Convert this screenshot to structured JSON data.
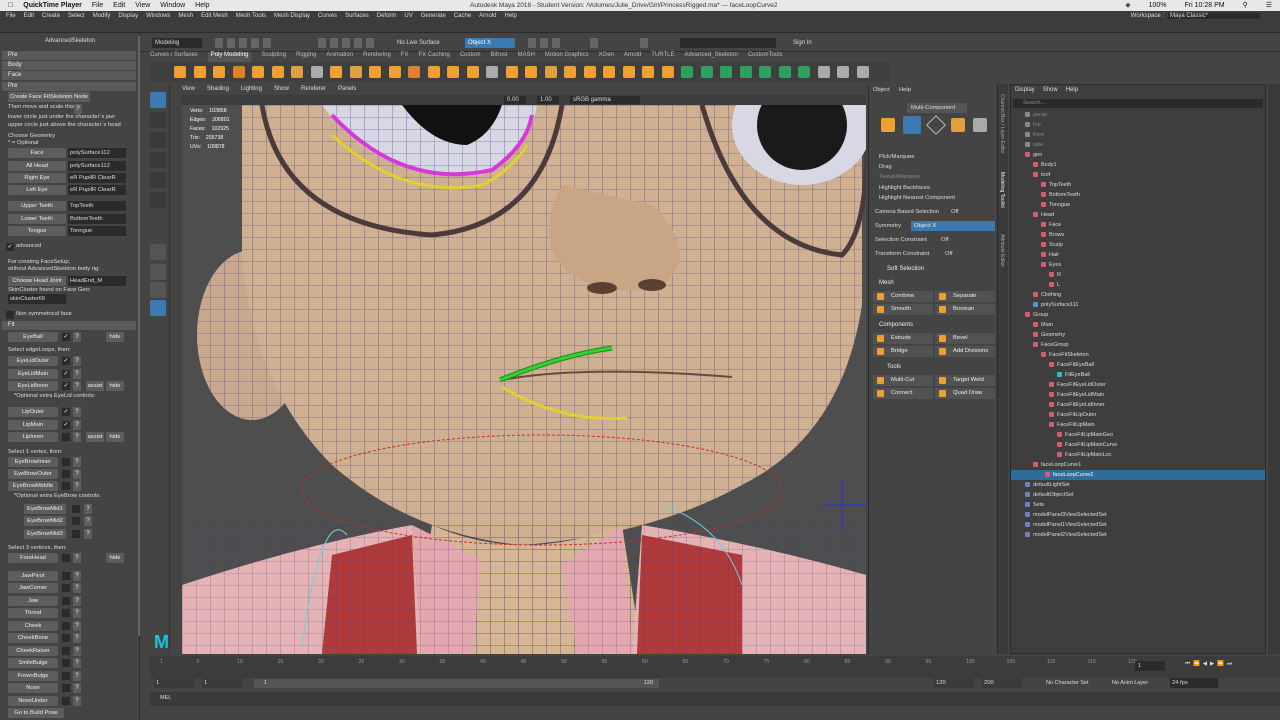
{
  "mac": {
    "app": "QuickTime Player",
    "menus": [
      "File",
      "Edit",
      "View",
      "Window",
      "Help"
    ],
    "window_title": "Autodesk Maya 2018 - Student Version: /Volumes/Julie_Drive/Girl/PrincessRigged.ma* --- faceLoopCurve2",
    "battery": "100%",
    "clock": "Fri 10:28 PM"
  },
  "maya_menu": {
    "items": [
      "File",
      "Edit",
      "Create",
      "Select",
      "Modify",
      "Display",
      "Windows",
      "Mesh",
      "Edit Mesh",
      "Mesh Tools",
      "Mesh Display",
      "Curves",
      "Surfaces",
      "Deform",
      "UV",
      "Generate",
      "Cache",
      "Arnold",
      "Help"
    ],
    "workspace_label": "Workspace :",
    "workspace_value": "Maya Classic*"
  },
  "statusline": {
    "mode": "Modeling",
    "live_surface": "No Live Surface",
    "symmetry": "Object X",
    "sign_in": "Sign In"
  },
  "shelf_tabs": [
    "Curves / Surfaces",
    "Poly Modeling",
    "Sculpting",
    "Rigging",
    "Animation",
    "Rendering",
    "FX",
    "FX Caching",
    "Custom",
    "Bifrost",
    "MASH",
    "Motion Graphics",
    "XGen",
    "Arnold",
    "TURTLE",
    "Advanced_Skeleton",
    "CustomTools"
  ],
  "left_panel": {
    "title": "AdvancedSkeleton",
    "sections": {
      "pre": "Pre",
      "body": "Body",
      "face": "Face",
      "pre2": "Pre",
      "fit": "Fit"
    },
    "create_btn": "Create Face FitSkeleton Node",
    "hint1": "Then move and scale this",
    "hint2": "lower circle just under the character`s jaw",
    "hint3": "upper circle just above the character`s head",
    "choose_geo": "Choose Geometry",
    "optional": "* = Optional",
    "geo_rows": [
      {
        "label": "Face",
        "value": "polySurface112"
      },
      {
        "label": "All Head",
        "value": "polySurface112"
      },
      {
        "label": "Right Eye",
        "value": "eR PupilR ClearR"
      },
      {
        "label": "Left Eye",
        "value": "eR PupilR ClearR"
      },
      {
        "label": "Upper Teeth",
        "value": "TopTeeth"
      },
      {
        "label": "Lower Teeth",
        "value": "BottomTeeth"
      },
      {
        "label": "Tongue",
        "value": "Tonngue"
      }
    ],
    "advanced": "advanced",
    "for_creating": "For creating FaceSetup,",
    "without_as": "without AdvancedSkeleton body rig:",
    "choose_head": "Choose Head Joint",
    "head_joint": "HeadEnd_M",
    "skincluster_found": "SkinCluster found on Face Geo:",
    "skincluster": "skinCluster66",
    "non_sym": "Non symmetrical face",
    "eyeball": "EyeBall",
    "hide": "hide",
    "assist": "assist",
    "select_edgeloops": "Select edgeLoops, then:",
    "eyelid": [
      "EyeLidOuter",
      "EyeLidMain",
      "EyeLidInner"
    ],
    "extra_eyelid": "*Optional extra EyeLid controls:",
    "lips": [
      "LipOuter",
      "LipMain",
      "LipInner"
    ],
    "select_1vertex": "Select 1 vertex, then:",
    "eyebrow": [
      "EyeBrowInner",
      "EyeBrowOuter",
      "EyeBrowMiddle"
    ],
    "extra_eyebrow": "*Optional extra EyeBrow controls:",
    "eyebrow_mid": [
      "EyeBrowMid1",
      "EyeBrowMid2",
      "EyeBrowMid3"
    ],
    "select_3vertices": "Select 3 vertices, then:",
    "forehead": "ForeHead",
    "lower_items": [
      "JawPivot",
      "JawCorner",
      "Jaw",
      "Throat",
      "Cheek",
      "CheekBone",
      "CheekRaiser",
      "SmileBulge",
      "FrownBulge",
      "Nose",
      "NoseUnder"
    ],
    "go_build": "Go to Build Pose",
    "qmark": "?"
  },
  "viewport": {
    "menu": [
      "View",
      "Shading",
      "Lighting",
      "Show",
      "Renderer",
      "Panels"
    ],
    "field1": "0.00",
    "field2": "1.00",
    "colorspace": "sRGB gamma",
    "hud_labels": [
      "Verts:",
      "Edges:",
      "Faces:",
      "Tris:",
      "UVs:"
    ],
    "hud_values": [
      "103858",
      "206801",
      "102925",
      "205738",
      "109878"
    ],
    "logo": "M"
  },
  "modeling_toolkit": {
    "menu": [
      "Object",
      "Help"
    ],
    "multi_component": "Multi-Component",
    "pick": [
      "Pick/Marquee",
      "Drag",
      "Tweak/Marquee"
    ],
    "highlight_backfaces": "Highlight Backfaces",
    "highlight_nearest": "Highlight Nearest Component",
    "camera_sel": "Camera Based Selection",
    "off": "Off",
    "symmetry": "Symmetry",
    "symmetry_val": "Object X",
    "sel_constraint": "Selection Constraint",
    "transform_constraint": "Transform Constraint",
    "soft_sel": "Soft Selection",
    "mesh": "Mesh",
    "mesh_btns": [
      "Combine",
      "Separate",
      "Smooth",
      "Boolean"
    ],
    "components": "Components",
    "comp_btns": [
      "Extrude",
      "Bevel",
      "Bridge",
      "Add Divisions"
    ],
    "tools": "Tools",
    "tool_btns": [
      "Multi-Cut",
      "Target Weld",
      "Connect",
      "Quad Draw"
    ],
    "vtab1": "Channel Box / Layer Editor",
    "vtab2": "Modeling Toolkit",
    "vtab3": "Attribute Editor"
  },
  "outliner": {
    "menu": [
      "Display",
      "Show",
      "Help"
    ],
    "search": "Search...",
    "items": [
      {
        "label": "persp",
        "indent": 0,
        "dim": true,
        "color": "#888"
      },
      {
        "label": "top",
        "indent": 0,
        "dim": true,
        "color": "#888"
      },
      {
        "label": "front",
        "indent": 0,
        "dim": true,
        "color": "#888"
      },
      {
        "label": "side",
        "indent": 0,
        "dim": true,
        "color": "#888"
      },
      {
        "label": "geo",
        "indent": 0,
        "dim": false,
        "color": "#d06070"
      },
      {
        "label": "Body1",
        "indent": 1,
        "dim": false,
        "color": "#d06070"
      },
      {
        "label": "toof",
        "indent": 1,
        "dim": false,
        "color": "#d06070"
      },
      {
        "label": "TopTeeth",
        "indent": 2,
        "dim": false,
        "color": "#d06070"
      },
      {
        "label": "BottomTeeth",
        "indent": 2,
        "dim": false,
        "color": "#d06070"
      },
      {
        "label": "Tonngue",
        "indent": 2,
        "dim": false,
        "color": "#d06070"
      },
      {
        "label": "Head",
        "indent": 1,
        "dim": false,
        "color": "#d06070"
      },
      {
        "label": "Face",
        "indent": 2,
        "dim": false,
        "color": "#d06070"
      },
      {
        "label": "Brows",
        "indent": 2,
        "dim": false,
        "color": "#d06070"
      },
      {
        "label": "Scalp",
        "indent": 2,
        "dim": false,
        "color": "#d06070"
      },
      {
        "label": "Hair",
        "indent": 2,
        "dim": false,
        "color": "#d06070"
      },
      {
        "label": "Eyes",
        "indent": 2,
        "dim": false,
        "color": "#d06070"
      },
      {
        "label": "R",
        "indent": 3,
        "dim": false,
        "color": "#d06070"
      },
      {
        "label": "L",
        "indent": 3,
        "dim": false,
        "color": "#d06070"
      },
      {
        "label": "Clothing",
        "indent": 1,
        "dim": false,
        "color": "#d06070"
      },
      {
        "label": "polySurface111",
        "indent": 1,
        "dim": false,
        "color": "#6090d0"
      },
      {
        "label": "Group",
        "indent": 0,
        "dim": false,
        "color": "#d06070"
      },
      {
        "label": "Main",
        "indent": 1,
        "dim": false,
        "color": "#d06070"
      },
      {
        "label": "Geometry",
        "indent": 1,
        "dim": false,
        "color": "#d06070"
      },
      {
        "label": "FaceGroup",
        "indent": 1,
        "dim": false,
        "color": "#d06070"
      },
      {
        "label": "FaceFitSkeleton",
        "indent": 2,
        "dim": false,
        "color": "#d06070"
      },
      {
        "label": "FaceFitEyeBall",
        "indent": 3,
        "dim": false,
        "color": "#d06070"
      },
      {
        "label": "FitEyeBall",
        "indent": 4,
        "dim": false,
        "color": "#30c0c0"
      },
      {
        "label": "FaceFitEyeLidOuter",
        "indent": 3,
        "dim": false,
        "color": "#d06070"
      },
      {
        "label": "FaceFitEyeLidMain",
        "indent": 3,
        "dim": false,
        "color": "#d06070"
      },
      {
        "label": "FaceFitEyeLidInner",
        "indent": 3,
        "dim": false,
        "color": "#d06070"
      },
      {
        "label": "FaceFitLipOuter",
        "indent": 3,
        "dim": false,
        "color": "#d06070"
      },
      {
        "label": "FaceFitLipMain",
        "indent": 3,
        "dim": false,
        "color": "#d06070"
      },
      {
        "label": "FaceFitLipMainGeo",
        "indent": 4,
        "dim": false,
        "color": "#d06070"
      },
      {
        "label": "FaceFitLipMainCurve",
        "indent": 4,
        "dim": false,
        "color": "#d06070"
      },
      {
        "label": "FaceFitLipMainLoc",
        "indent": 4,
        "dim": false,
        "color": "#d06070"
      },
      {
        "label": "faceLoopCurve1",
        "indent": 1,
        "dim": false,
        "color": "#d06070"
      },
      {
        "label": "faceLoopCurve2",
        "indent": 1,
        "dim": false,
        "color": "#d06070",
        "selected": true
      },
      {
        "label": "defaultLightSet",
        "indent": 0,
        "dim": false,
        "color": "#7080c0"
      },
      {
        "label": "defaultObjectSet",
        "indent": 0,
        "dim": false,
        "color": "#7080c0"
      },
      {
        "label": "Sets",
        "indent": 0,
        "dim": false,
        "color": "#7080c0"
      },
      {
        "label": "modelPanel3ViewSelectedSet",
        "indent": 0,
        "dim": false,
        "color": "#7080c0"
      },
      {
        "label": "modelPanel1ViewSelectedSet",
        "indent": 0,
        "dim": false,
        "color": "#7080c0"
      },
      {
        "label": "modelPanel2ViewSelectedSet",
        "indent": 0,
        "dim": false,
        "color": "#7080c0"
      }
    ]
  },
  "timeline": {
    "ticks": [
      "1",
      "5",
      "10",
      "15",
      "20",
      "25",
      "30",
      "35",
      "40",
      "45",
      "50",
      "55",
      "60",
      "65",
      "70",
      "75",
      "80",
      "85",
      "90",
      "95",
      "100",
      "105",
      "110",
      "115",
      "120"
    ],
    "current_frame": "1",
    "range_start": "1",
    "range_start2": "1",
    "range_inner_start": "1",
    "range_inner_end": "120",
    "range_end": "120",
    "range_end2": "200",
    "character_set": "No Character Set",
    "anim_layer": "No Anim Layer",
    "fps": "24 fps",
    "mel": "MEL"
  }
}
